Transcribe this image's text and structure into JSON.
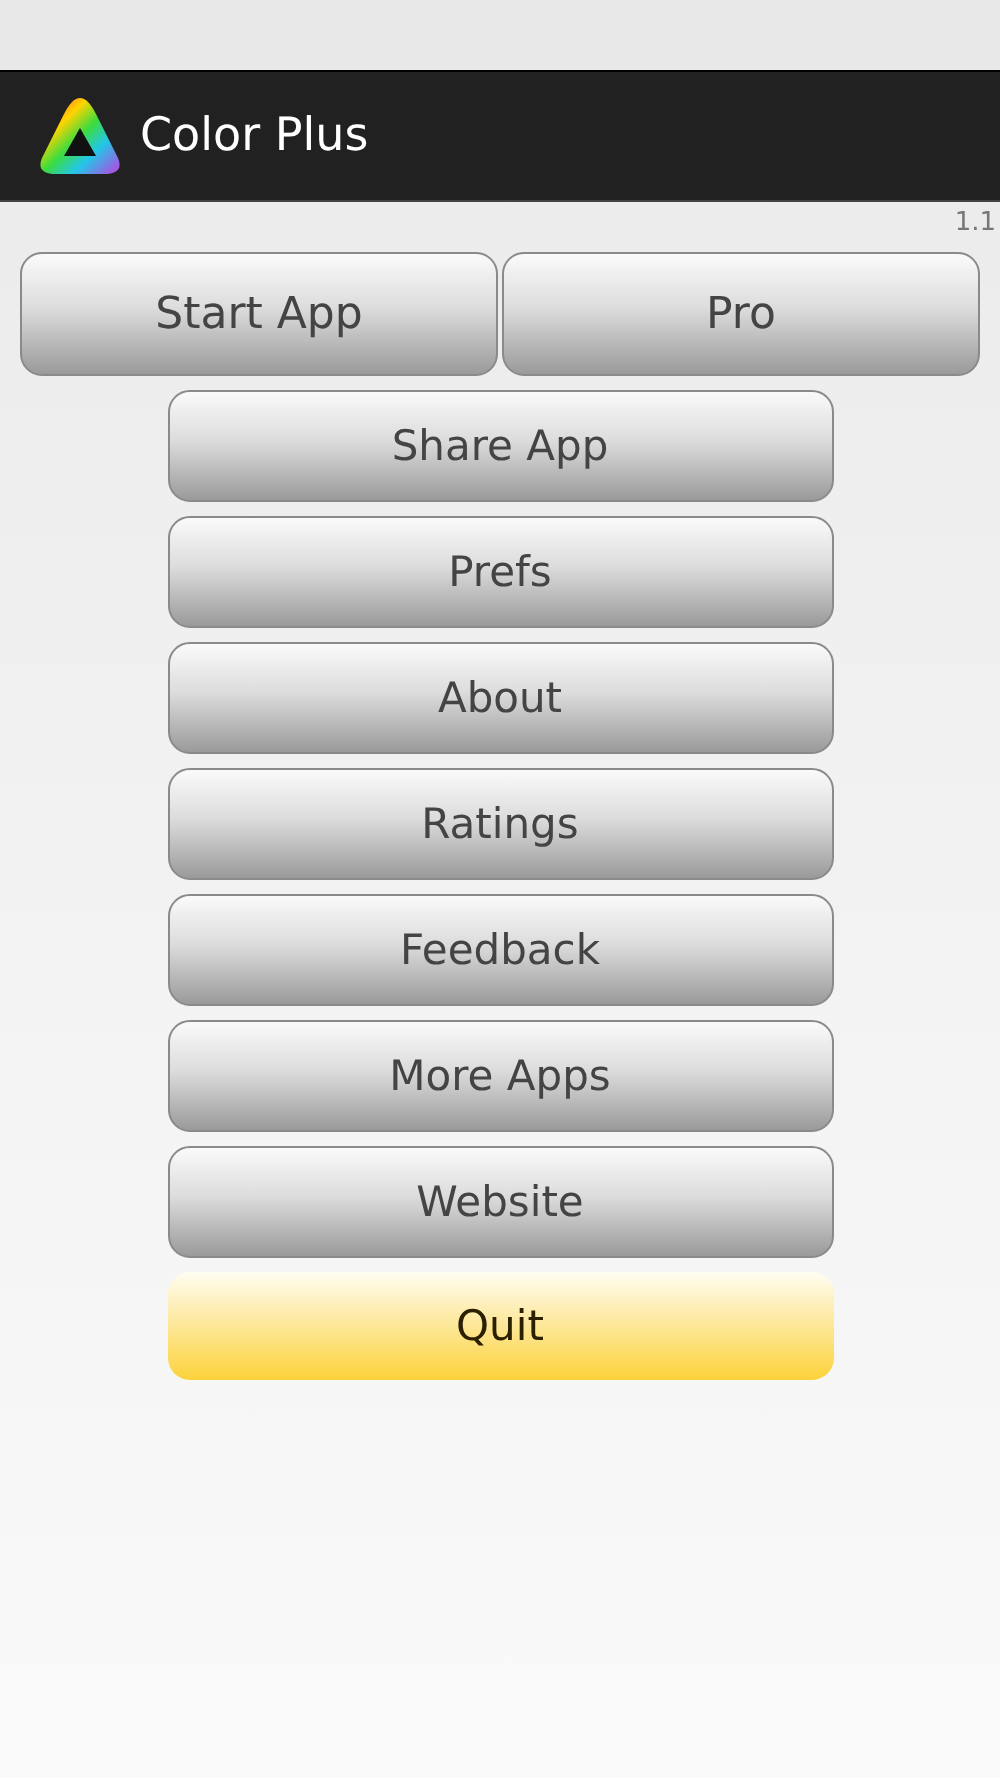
{
  "action_bar": {
    "title": "Color Plus"
  },
  "version": "1.1",
  "top_buttons": [
    "Start App",
    "Pro"
  ],
  "menu_buttons": [
    {
      "label": "Share App",
      "focused": false
    },
    {
      "label": "Prefs",
      "focused": false
    },
    {
      "label": "About",
      "focused": false
    },
    {
      "label": "Ratings",
      "focused": false
    },
    {
      "label": "Feedback",
      "focused": false
    },
    {
      "label": "More Apps",
      "focused": false
    },
    {
      "label": "Website",
      "focused": false
    },
    {
      "label": "Quit",
      "focused": true
    }
  ]
}
